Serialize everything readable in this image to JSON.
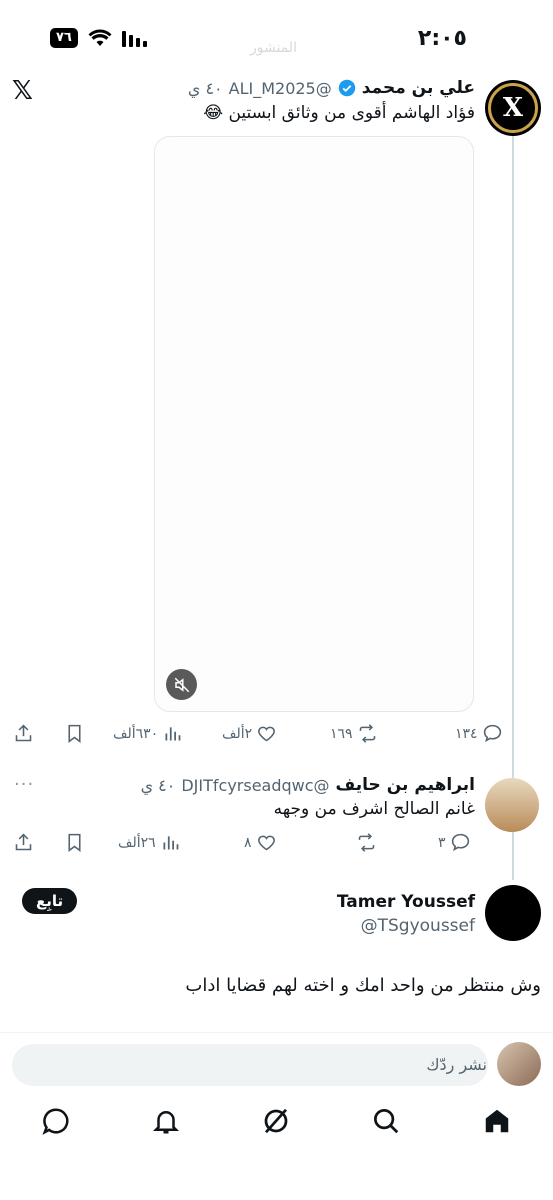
{
  "status_bar": {
    "time": "٢:٠٥",
    "battery": "٧٦",
    "faint_title": "المنشور"
  },
  "tweet1": {
    "name": "علي بن محمد",
    "handle": "@ALI_M2025",
    "time": "٤٠ ي",
    "text": "فؤاد الهاشم أقوى من وثائق ابستين 😂",
    "actions": {
      "replies": "١٣٤",
      "reposts": "١٦٩",
      "likes": "٢ألف",
      "views": "٦٣٠ألف"
    }
  },
  "tweet2": {
    "name": "ابراهيم بن حايف",
    "handle": "@DJITfcyrseadqwc",
    "time": "٤٠ ي",
    "text": "غانم الصالح اشرف من وجهه",
    "actions": {
      "replies": "٣",
      "reposts": "",
      "likes": "٨",
      "views": "٢٦ألف"
    }
  },
  "tweet3": {
    "name": "Tamer Youssef",
    "handle": "@TSgyoussef",
    "follow_label": "تابِع",
    "text": "وش منتظر من واحد امك و اخته لهم قضايا اداب"
  },
  "reply": {
    "placeholder": "نشر ردّك"
  },
  "colors": {
    "verified": "#1d9bf0",
    "text_secondary": "#536471"
  }
}
